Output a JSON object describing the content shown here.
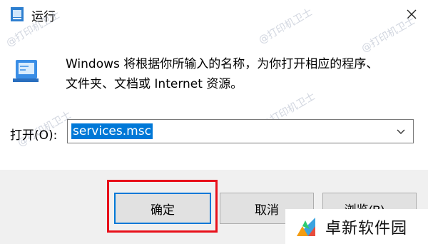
{
  "window": {
    "title": "运行",
    "close_icon": "close-icon"
  },
  "description": {
    "line1": "Windows 将根据你所输入的名称，为你打开相应的程序、",
    "line2": "文件夹、文档或 Internet 资源。"
  },
  "open_field": {
    "label": "打开(O):",
    "value": "services.msc"
  },
  "buttons": {
    "ok": "确定",
    "cancel": "取消",
    "browse": "浏览(B)..."
  },
  "watermark": "@打印机卫士",
  "brand": {
    "name": "卓新软件园"
  },
  "colors": {
    "highlight": "#e8101a",
    "selection": "#0078d7"
  }
}
